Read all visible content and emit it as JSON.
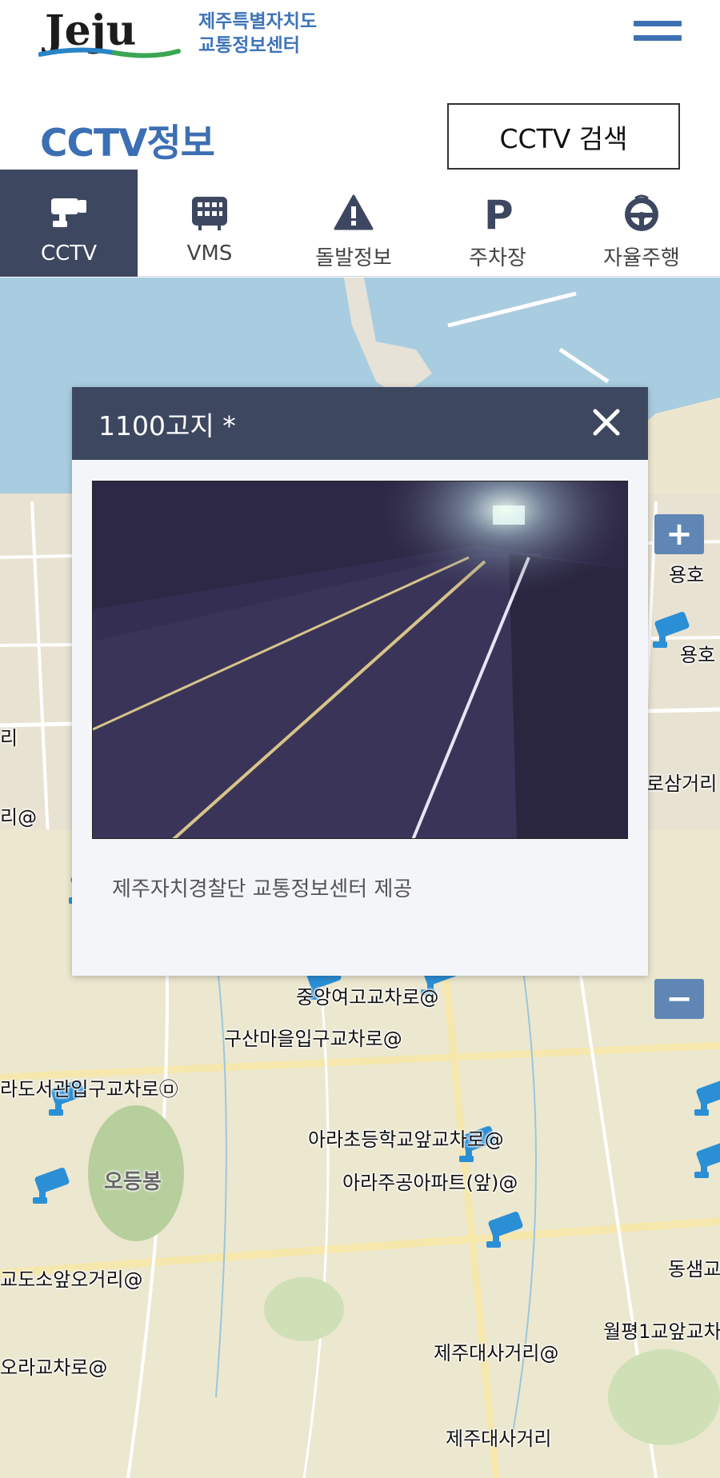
{
  "header": {
    "logo_text": "Jeju",
    "org_line1": "제주특별자치도",
    "org_line2": "교통정보센터",
    "menu_icon": "hamburger-icon"
  },
  "page": {
    "title": "CCTV정보",
    "search_button": "CCTV 검색"
  },
  "tabs": [
    {
      "label": "CCTV",
      "icon": "cctv-camera-icon",
      "active": true
    },
    {
      "label": "VMS",
      "icon": "vms-sign-icon",
      "active": false
    },
    {
      "label": "돌발정보",
      "icon": "warning-icon",
      "active": false
    },
    {
      "label": "주차장",
      "icon": "parking-icon",
      "active": false
    },
    {
      "label": "자율주행",
      "icon": "steering-wheel-icon",
      "active": false
    }
  ],
  "popup": {
    "title": "1100고지 *",
    "credit": "제주자치경찰단 교통정보센터 제공"
  },
  "map": {
    "zoom_in": "+",
    "zoom_out": "−",
    "labels": [
      "중앙여고교차로@",
      "구산마을입구교차로@",
      "라도서관입구교차로㉤",
      "아라초등학교앞교차로@",
      "아라주공아파트(앞)@",
      "오등봉",
      "교도소앞오거리@",
      "동샘교",
      "월평1교앞교차",
      "오라교차로@",
      "제주대사거리@",
      "제주대사거리",
      "용호",
      "용호",
      "로삼거리",
      "리",
      "리@"
    ]
  },
  "colors": {
    "brand_blue": "#3c6fb3",
    "navy": "#3d4760",
    "cctv_pin": "#2b8fd6",
    "sea": "#a9cde0"
  }
}
